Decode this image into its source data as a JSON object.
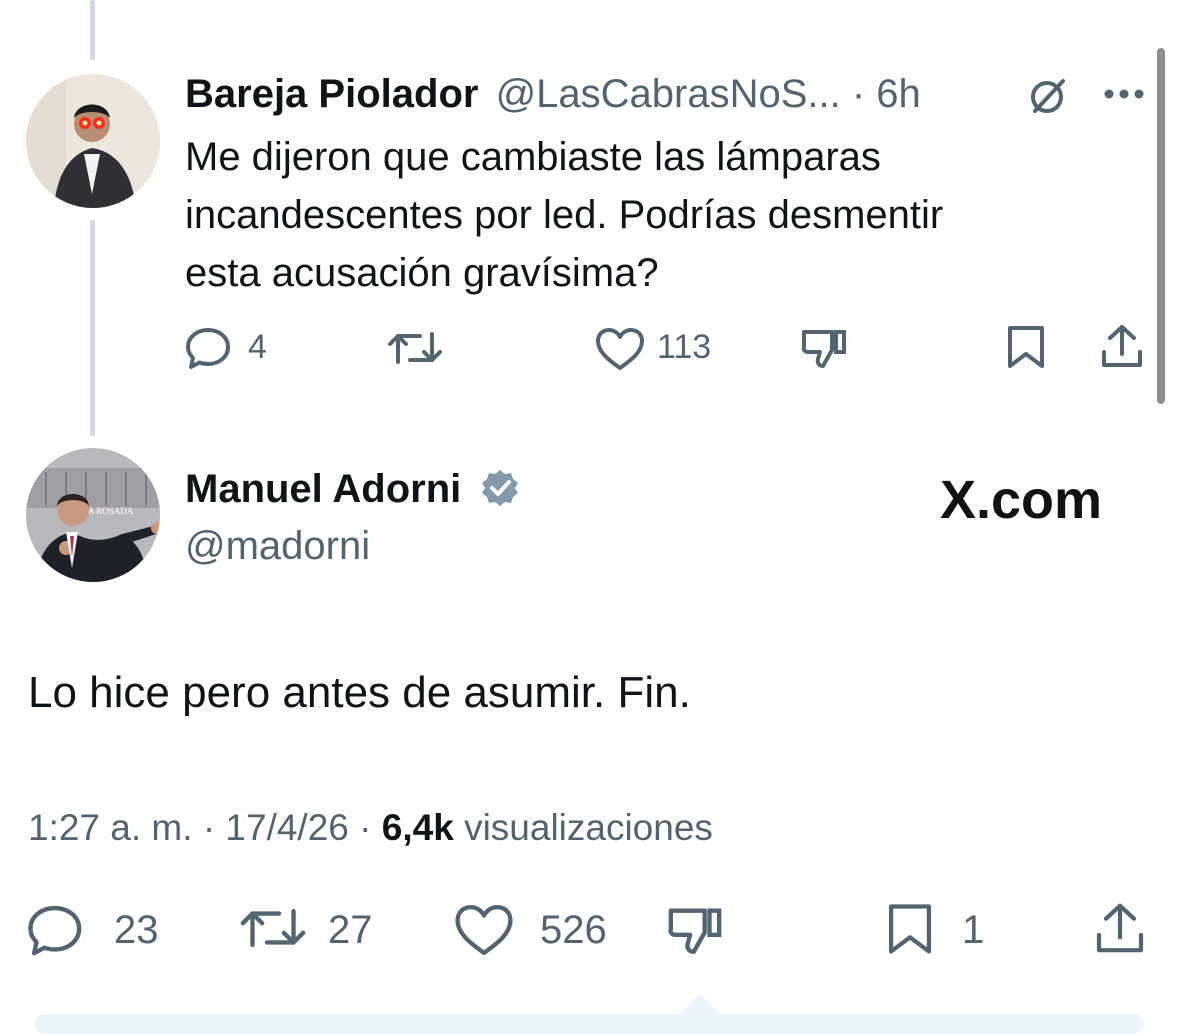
{
  "reply_tweet": {
    "display_name": "Bareja Piolador",
    "handle_time": "@LasCabrasNoS... · 6h",
    "text_lines": [
      "Me dijeron que cambiaste las lámparas",
      "incandescentes por led. Podrías desmentir",
      "esta acusación gravísima?"
    ],
    "actions": {
      "reply_count": "4",
      "retweet_count": "",
      "like_count": "113"
    },
    "icons": [
      "grok-icon",
      "more-icon",
      "reply-icon",
      "retweet-icon",
      "like-icon",
      "dislike-icon",
      "bookmark-icon",
      "share-icon"
    ]
  },
  "main_tweet": {
    "display_name": "Manuel Adorni",
    "handle": "@madorni",
    "watermark": "X.com",
    "avatar_caption": "A ROSADA",
    "text": "Lo hice pero antes de asumir. Fin.",
    "time": "1:27 a. m.",
    "sep1": "·",
    "date": "17/4/26",
    "sep2": "·",
    "views_count": "6,4k",
    "views_label": "visualizaciones",
    "actions": {
      "reply_count": "23",
      "retweet_count": "27",
      "like_count": "526",
      "bookmark_count": "1"
    },
    "verified_color": "#829aab"
  },
  "colors": {
    "text": "#0f1419",
    "muted": "#536471",
    "thread_line": "#cfd9de"
  }
}
